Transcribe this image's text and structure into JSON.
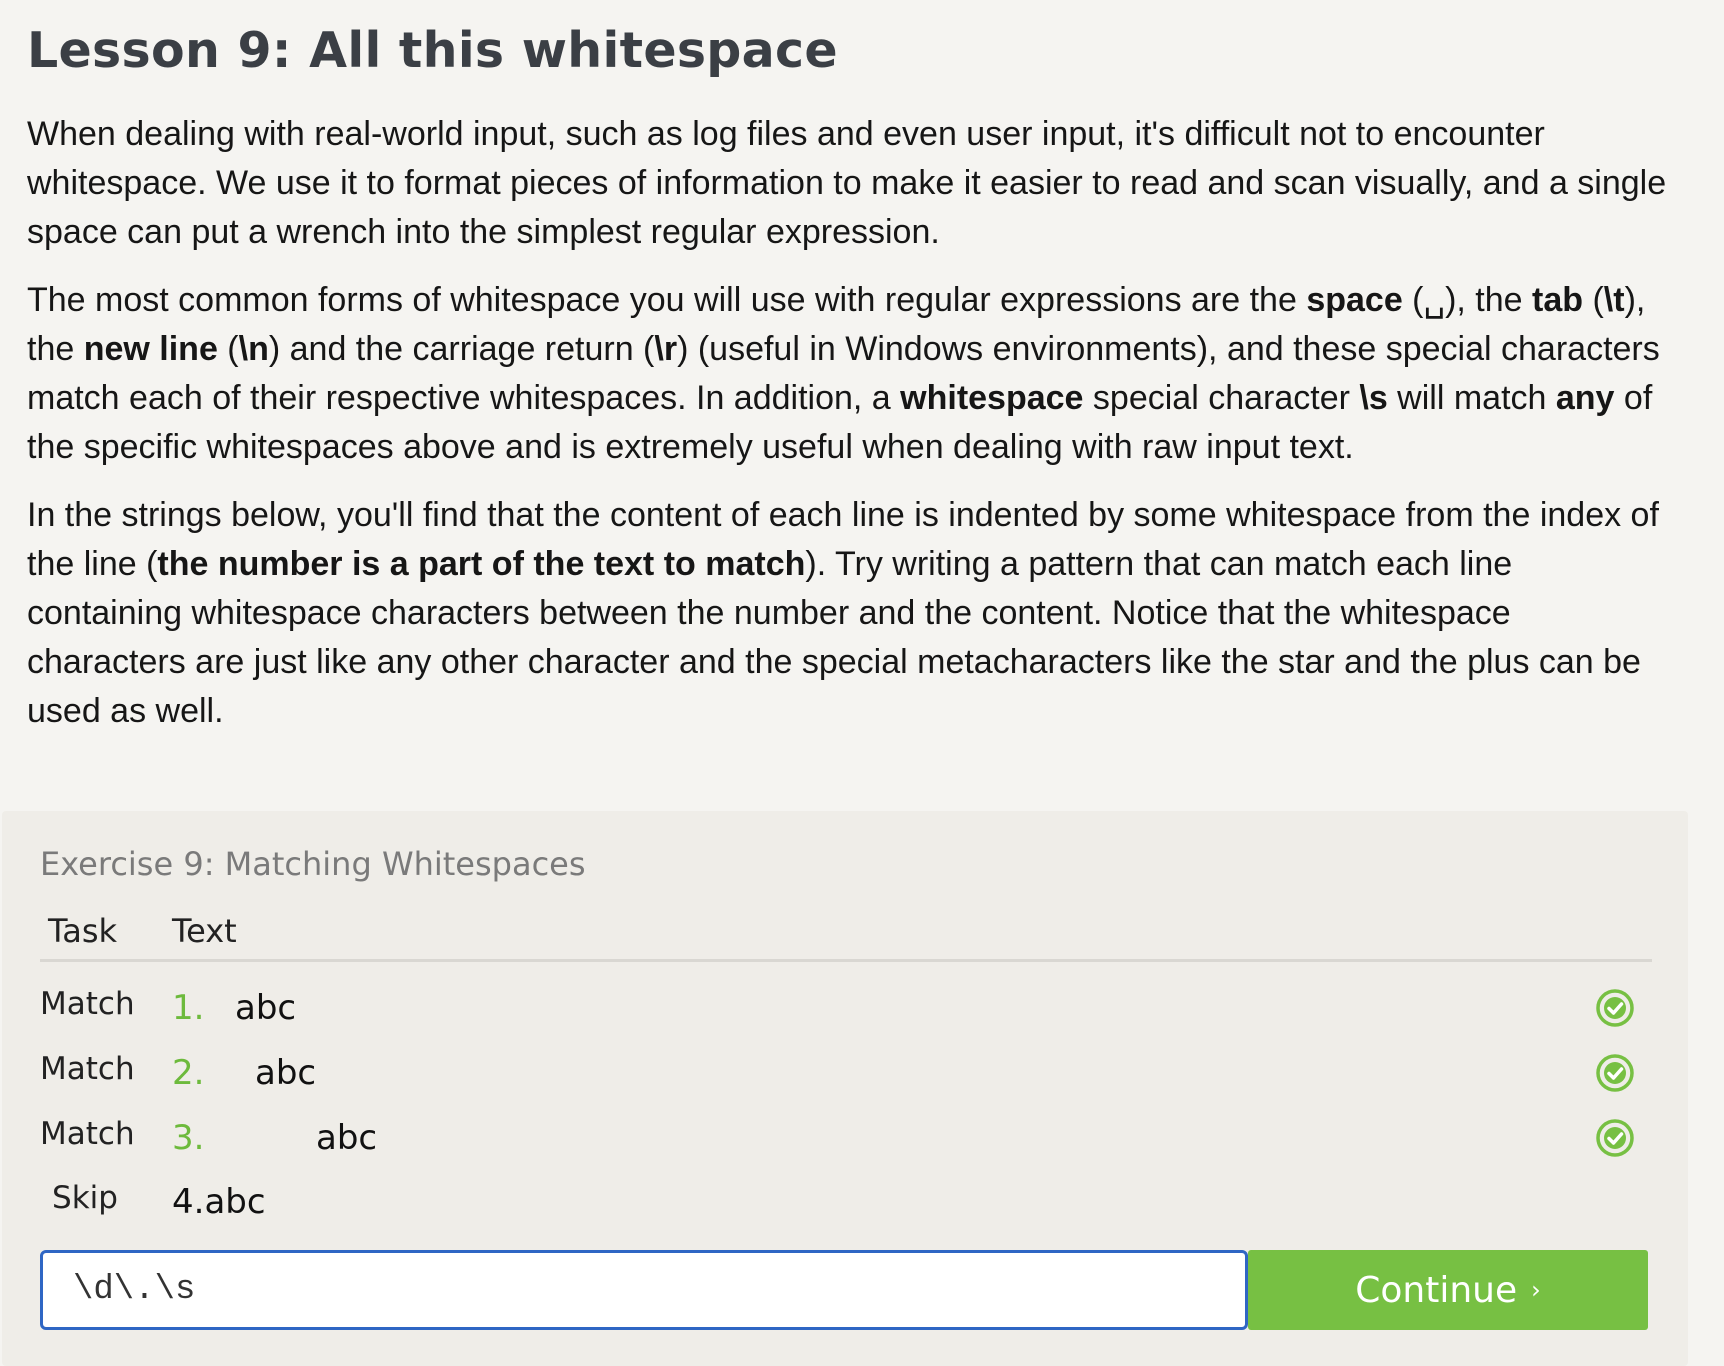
{
  "lesson": {
    "title": "Lesson 9: All this whitespace",
    "para1": "When dealing with real-world input, such as log files and even user input, it's difficult not to encounter whitespace. We use it to format pieces of information to make it easier to read and scan visually, and a single space can put a wrench into the simplest regular expression.",
    "para2": {
      "t1": "The most common forms of whitespace you will use with regular expressions are the ",
      "b1": "space",
      "t2": " (␣), the ",
      "b2": "tab",
      "t3": " (",
      "b3": "\\t",
      "t4": "), the ",
      "b4": "new line",
      "t5": " (",
      "b5": "\\n",
      "t6": ") and the carriage return (",
      "b6": "\\r",
      "t7": ") (useful in Windows environments), and these special characters match each of their respective whitespaces. In addition, a ",
      "b7": "whitespace",
      "t8": " special character ",
      "b8": "\\s",
      "t9": " will match ",
      "b9": "any",
      "t10": " of the specific whitespaces above and is extremely useful when dealing with raw input text."
    },
    "para3": {
      "t1": "In the strings below, you'll find that the content of each line is indented by some whitespace from the index of the line (",
      "b1": "the number is a part of the text to match",
      "t2": "). Try writing a pattern that can match each line containing whitespace characters between the number and the content. Notice that the whitespace characters are just like any other character and the special metacharacters like the star and the plus can be used as well."
    }
  },
  "exercise": {
    "title": "Exercise 9: Matching Whitespaces",
    "col_task": "Task",
    "col_text": "Text",
    "rows": [
      {
        "task": "Match",
        "num": "1.",
        "text": "abc",
        "status": "matched"
      },
      {
        "task": "Match",
        "num": "2.",
        "text": "abc",
        "status": "matched"
      },
      {
        "task": "Match",
        "num": "3.",
        "text": "abc",
        "status": "matched"
      },
      {
        "task": "Skip",
        "text": "4.abc"
      }
    ],
    "input_value": "\\d\\.\\s",
    "continue_label": "Continue",
    "continue_chevron": "›",
    "check_icon": "check-circle-icon",
    "accent_color": "#77c043"
  }
}
